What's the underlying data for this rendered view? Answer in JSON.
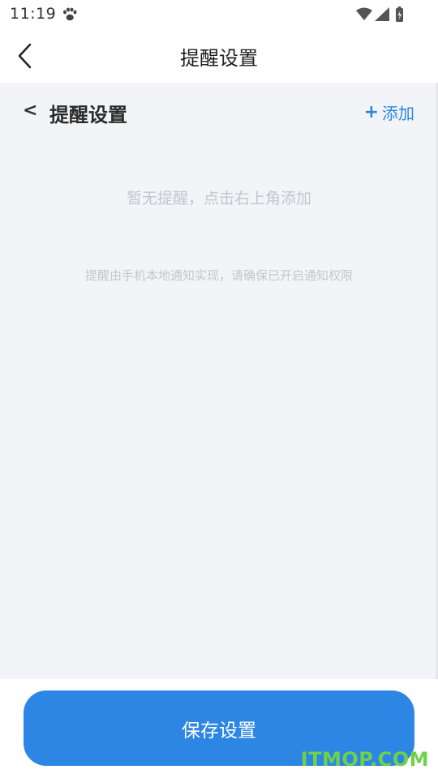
{
  "status_bar": {
    "time": "11:19",
    "icons": [
      "paw-icon",
      "wifi-icon",
      "signal-icon",
      "battery-charging-icon"
    ]
  },
  "header": {
    "title": "提醒设置",
    "back_icon": "chevron-left-icon"
  },
  "section": {
    "back_label": "<",
    "title": "提醒设置",
    "add_plus": "+",
    "add_label": "添加"
  },
  "empty_state": {
    "message": "暂无提醒，点击右上角添加",
    "hint": "提醒由手机本地通知实现，请确保已开启通知权限"
  },
  "footer": {
    "save_label": "保存设置"
  },
  "watermark": "ITMOP.COM",
  "colors": {
    "accent": "#2d86e4",
    "background": "#f3f4f8",
    "muted_text": "#c4c6cb",
    "watermark": "#6fd04a"
  }
}
